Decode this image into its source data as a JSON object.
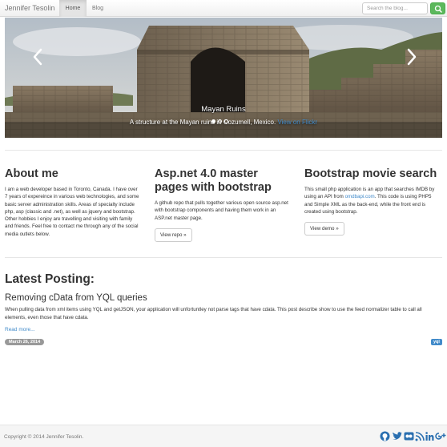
{
  "navbar": {
    "brand": "Jennifer Tesolin",
    "links": [
      "Home",
      "Blog"
    ],
    "search_placeholder": "Search the blog..."
  },
  "carousel": {
    "title": "Mayan Ruins",
    "text": "A structure at the Mayan ruins in Cozumell, Mexico.",
    "link": "View on Flickr",
    "slides": 3,
    "active_slide": 1
  },
  "columns": [
    {
      "heading": "About me",
      "body": "I am a web developer based in Toronto, Canada. I have over 7 years of expereince in various web technologies, and some basic server administration skills. Areas of specialty include php, asp (classic and .net), as well as jquery and bootstrap. Other hobbies I enjoy are travelling and visiting with family and friends. Feel free to contact me through any of the social media outlets below."
    },
    {
      "heading": "Asp.net 4.0 master pages with bootstrap",
      "body": "A github repo that pulls together various open source asp.net with bootstrap components and having them work in an ASP.net master page.",
      "button": "View repo »"
    },
    {
      "heading": "Bootstrap movie search",
      "body_before": "This small php application is an app that searches IMDB by using an API from ",
      "body_link": "omdbapi.com",
      "body_after": ". This code is using PHP5 and Simple XML as the back-end, while the front end is created using bootstrap.",
      "button": "View demo »"
    }
  ],
  "latest": {
    "heading": "Latest Posting:",
    "post": {
      "title": "Removing cData from YQL queries",
      "body": "When pulling data from xml items using YQL and getJSON, your application will unfortuntley not parse tags that have cdata. This post describe show to use the feed normalizer table to call all elements, even those that have cdata.",
      "read_more": "Read more...",
      "date": "March 26, 2014",
      "tag": "yql"
    }
  },
  "footer": {
    "copyright": "Copyright © 2014 Jennifer Tesolin.",
    "social_icons": [
      "github-icon",
      "twitter-icon",
      "flickr-icon",
      "rss-icon",
      "linkedin-icon",
      "google-plus-icon"
    ]
  },
  "colors": {
    "link": "#428bca",
    "search_button": "#5cb85c",
    "date_badge": "#999999",
    "tag_label": "#428bca"
  }
}
